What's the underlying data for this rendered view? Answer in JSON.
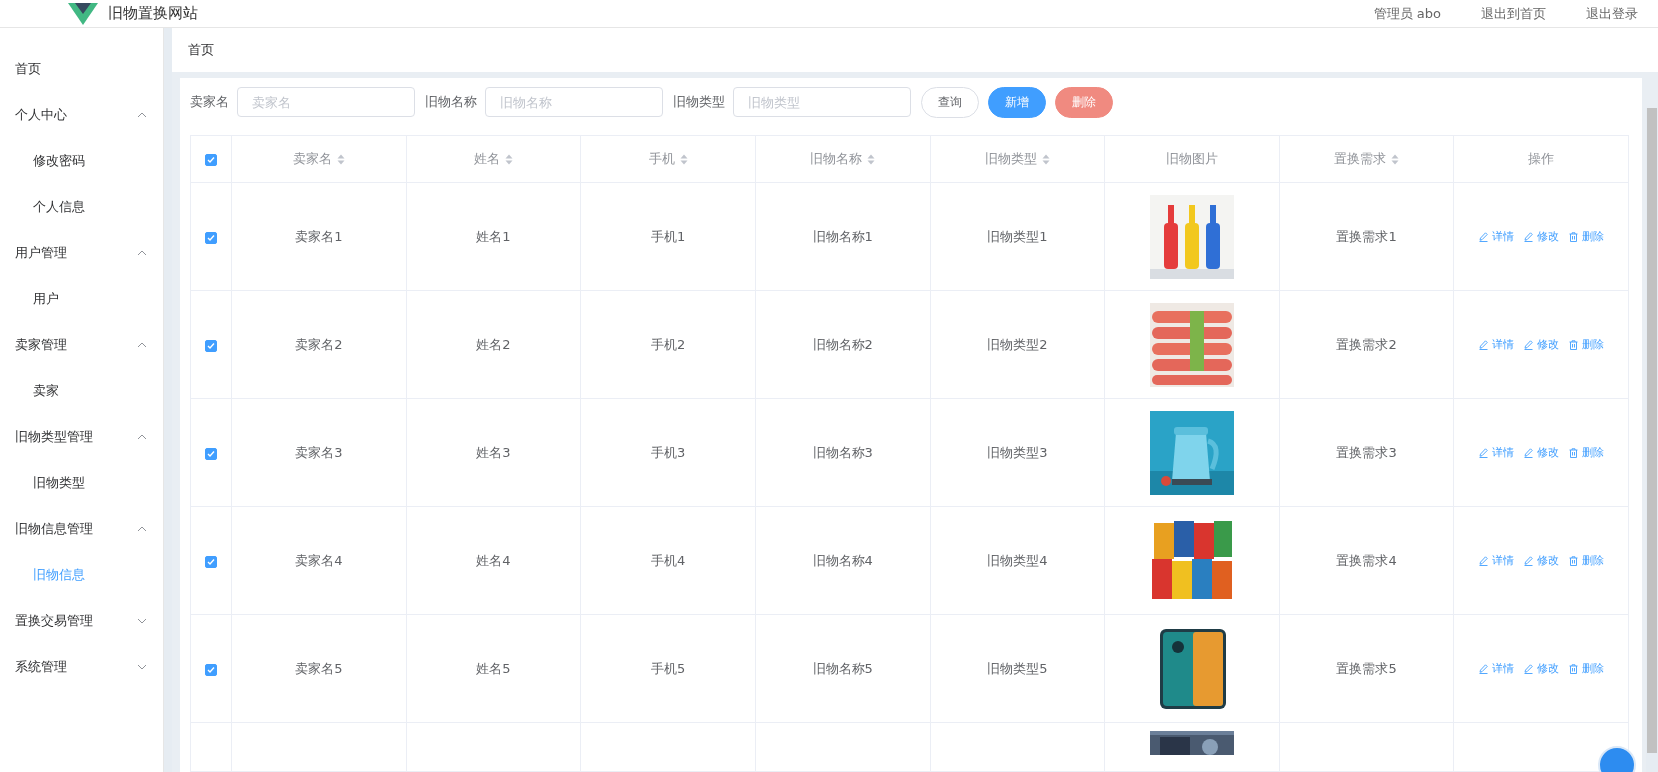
{
  "header": {
    "site_title": "旧物置换网站",
    "user": "管理员 abo",
    "links": [
      "退出到首页",
      "退出登录"
    ]
  },
  "sidebar": {
    "items": [
      {
        "label": "首页",
        "selected": false
      },
      {
        "label": "个人中心",
        "expanded": true,
        "children": [
          {
            "label": "修改密码",
            "selected": false
          },
          {
            "label": "个人信息",
            "selected": false
          }
        ]
      },
      {
        "label": "用户管理",
        "expanded": true,
        "children": [
          {
            "label": "用户",
            "selected": false
          }
        ]
      },
      {
        "label": "卖家管理",
        "expanded": true,
        "children": [
          {
            "label": "卖家",
            "selected": false
          }
        ]
      },
      {
        "label": "旧物类型管理",
        "expanded": true,
        "children": [
          {
            "label": "旧物类型",
            "selected": false
          }
        ]
      },
      {
        "label": "旧物信息管理",
        "expanded": true,
        "children": [
          {
            "label": "旧物信息",
            "selected": true
          }
        ]
      },
      {
        "label": "置换交易管理",
        "expanded": false
      },
      {
        "label": "系统管理",
        "expanded": false
      }
    ]
  },
  "breadcrumb": "首页",
  "search": {
    "fields": [
      {
        "label": "卖家名",
        "placeholder": "卖家名"
      },
      {
        "label": "旧物名称",
        "placeholder": "旧物名称"
      },
      {
        "label": "旧物类型",
        "placeholder": "旧物类型"
      }
    ],
    "buttons": [
      {
        "label": "查询",
        "kind": "plain"
      },
      {
        "label": "新增",
        "kind": "primary"
      },
      {
        "label": "删除",
        "kind": "danger"
      }
    ]
  },
  "table": {
    "all_checked": true,
    "columns": [
      {
        "label": "卖家名",
        "sortable": true
      },
      {
        "label": "姓名",
        "sortable": true
      },
      {
        "label": "手机",
        "sortable": true
      },
      {
        "label": "旧物名称",
        "sortable": true
      },
      {
        "label": "旧物类型",
        "sortable": true
      },
      {
        "label": "旧物图片",
        "sortable": false
      },
      {
        "label": "置换需求",
        "sortable": true
      },
      {
        "label": "操作",
        "sortable": false
      }
    ],
    "rows": [
      {
        "checked": true,
        "cells": [
          "卖家名1",
          "姓名1",
          "手机1",
          "旧物名称1",
          "旧物类型1"
        ],
        "demand": "置换需求1",
        "actions": [
          "详情",
          "修改",
          "删除"
        ]
      },
      {
        "checked": true,
        "cells": [
          "卖家名2",
          "姓名2",
          "手机2",
          "旧物名称2",
          "旧物类型2"
        ],
        "demand": "置换需求2",
        "actions": [
          "详情",
          "修改",
          "删除"
        ]
      },
      {
        "checked": true,
        "cells": [
          "卖家名3",
          "姓名3",
          "手机3",
          "旧物名称3",
          "旧物类型3"
        ],
        "demand": "置换需求3",
        "actions": [
          "详情",
          "修改",
          "删除"
        ]
      },
      {
        "checked": true,
        "cells": [
          "卖家名4",
          "姓名4",
          "手机4",
          "旧物名称4",
          "旧物类型4"
        ],
        "demand": "置换需求4",
        "actions": [
          "详情",
          "修改",
          "删除"
        ]
      },
      {
        "checked": true,
        "cells": [
          "卖家名5",
          "姓名5",
          "手机5",
          "旧物名称5",
          "旧物类型5"
        ],
        "demand": "置换需求5",
        "actions": [
          "详情",
          "修改",
          "删除"
        ]
      }
    ],
    "cut_off_row": {
      "picture": true
    }
  }
}
